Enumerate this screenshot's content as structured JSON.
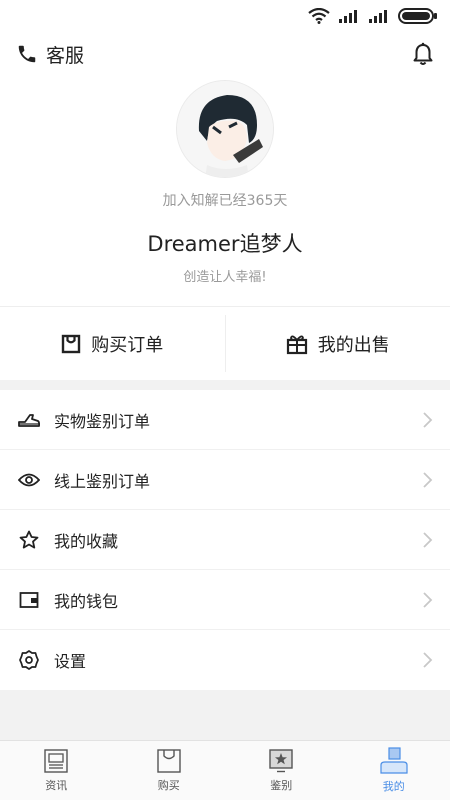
{
  "status_bar": {
    "icons": [
      "wifi-icon",
      "signal-icon",
      "signal-icon",
      "battery-icon"
    ]
  },
  "header": {
    "customer_service_label": "客服",
    "customer_service_icon": "phone-icon",
    "notification_icon": "bell-icon"
  },
  "profile": {
    "joined_text": "加入知解已经365天",
    "username": "Dreamer追梦人",
    "motto": "创造让人幸福!"
  },
  "orders": {
    "buy_label": "购买订单",
    "buy_icon": "bag-icon",
    "sell_label": "我的出售",
    "sell_icon": "gift-icon"
  },
  "menu": {
    "items": [
      {
        "label": "实物鉴别订单",
        "icon": "sneaker-icon"
      },
      {
        "label": "线上鉴别订单",
        "icon": "eye-icon"
      },
      {
        "label": "我的收藏",
        "icon": "star-icon"
      },
      {
        "label": "我的钱包",
        "icon": "wallet-icon"
      },
      {
        "label": "设置",
        "icon": "gear-icon"
      }
    ]
  },
  "tabbar": {
    "tabs": [
      {
        "label": "资讯",
        "icon": "news-icon"
      },
      {
        "label": "购买",
        "icon": "shopping-bag-icon"
      },
      {
        "label": "鉴别",
        "icon": "appraisal-icon"
      },
      {
        "label": "我的",
        "icon": "profile-icon",
        "active": true
      }
    ]
  },
  "colors": {
    "accent": "#4a8ee6",
    "text_primary": "#222222",
    "text_secondary": "#9a9a9a",
    "band": "#f2f2f2"
  }
}
